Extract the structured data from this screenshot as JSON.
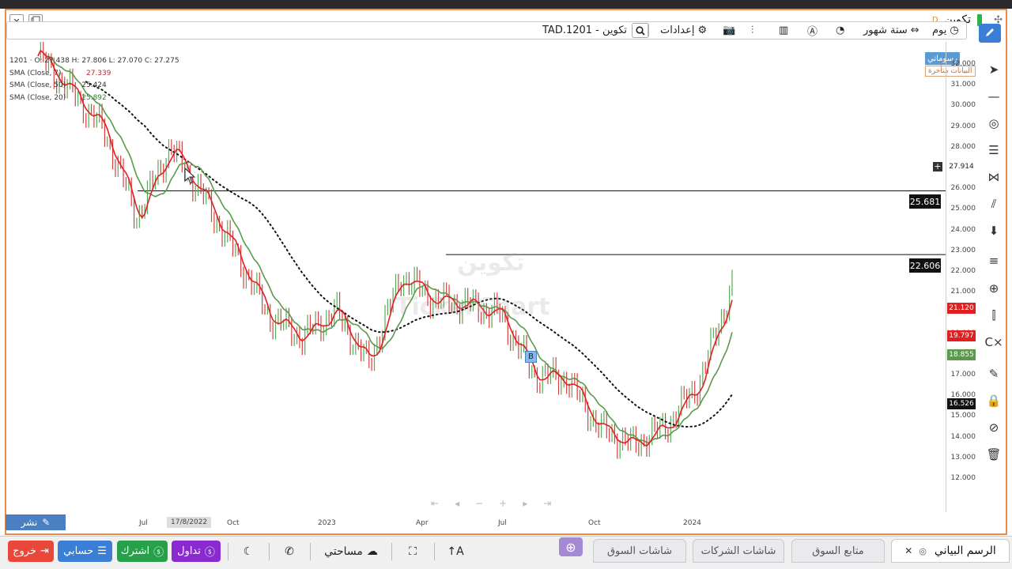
{
  "window": {
    "title": "تكوين",
    "title_badge": "D",
    "close_label": "✕"
  },
  "toolbar": {
    "symbol": "TAD.1201 - تكوين",
    "settings_label": "إعدادات",
    "period_label": "ستة شهور",
    "interval_label": "يوم"
  },
  "legend": {
    "ohlc": "1201 · O: 27.438  H: 27.806  L: 27.070  C: 27.275",
    "ohlc_short": "1201",
    "ohlc_values": "H: 27.806  L: 27.070  C: 27.275",
    "sma1_label": "SMA (Close, 7)",
    "sma1_value": "27.339",
    "sma2_label": "SMA (Close, 50)",
    "sma2_value": "25.424",
    "sma3_label": "SMA (Close, 20)",
    "sma3_value": "25.892"
  },
  "drawings_badge": "رسوماتي",
  "delayed_badge": "البيانات متأخرة",
  "watermark_name": "تكوين",
  "watermark_brand": "TickerChart",
  "marker_b": "B",
  "price_axis": {
    "ticks": [
      "32.000",
      "31.000",
      "30.000",
      "29.000",
      "28.000",
      "27.000",
      "26.000",
      "25.000",
      "24.000",
      "23.000",
      "22.000",
      "21.000",
      "20.000",
      "19.000",
      "18.000",
      "17.000",
      "16.000",
      "15.000",
      "14.000",
      "13.000",
      "12.000"
    ],
    "current_crosshair": "27.914",
    "last_price": "21.120",
    "sma_red_value": "19.797",
    "sma_green_value": "18.855",
    "sma_dotted_value": "16.526"
  },
  "levels": {
    "upper": "25.681",
    "lower": "22.606"
  },
  "date_axis": {
    "ticks": [
      "Jul",
      "Oct",
      "2023",
      "Apr",
      "Jul",
      "Oct",
      "2024"
    ],
    "selected": "17/8/2022"
  },
  "share_label": "نشر",
  "bottom": {
    "logout": "خروج",
    "account": "حسابي",
    "subscribe": "اشترك",
    "trade": "تداول",
    "workspace": "مساحتي",
    "tabs": [
      "شاشات السوق",
      "شاشات الشركات",
      "متابع السوق",
      "الرسم البياني"
    ]
  },
  "colors": {
    "accent_orange": "#f08a4b",
    "price_line": "#e02020",
    "sma_green": "#5a9a4a",
    "logout": "#e8473a",
    "account": "#3a7fd5",
    "subscribe": "#27a04a",
    "trade": "#8a2bd0"
  },
  "chart_data": {
    "type": "line",
    "x": [
      "2022-05",
      "2022-06",
      "2022-07",
      "2022-08",
      "2022-09",
      "2022-10",
      "2022-11",
      "2022-12",
      "2023-01",
      "2023-02",
      "2023-03",
      "2023-04",
      "2023-05",
      "2023-06",
      "2023-07",
      "2023-08",
      "2023-09",
      "2023-10",
      "2023-11",
      "2023-12",
      "2024-01",
      "2024-02"
    ],
    "series": [
      {
        "values": [
          32.2,
          30.5,
          28.6,
          24.4,
          27.8,
          25.4,
          22.6,
          19.6,
          18.6,
          19.9,
          17.3,
          21.6,
          20.4,
          20.2,
          19.7,
          16.8,
          16.6,
          14.2,
          13.4,
          14.3,
          16.4,
          21.1
        ]
      }
    ],
    "ylim": [
      12,
      32.5
    ],
    "levels": [
      25.681,
      22.606
    ]
  }
}
